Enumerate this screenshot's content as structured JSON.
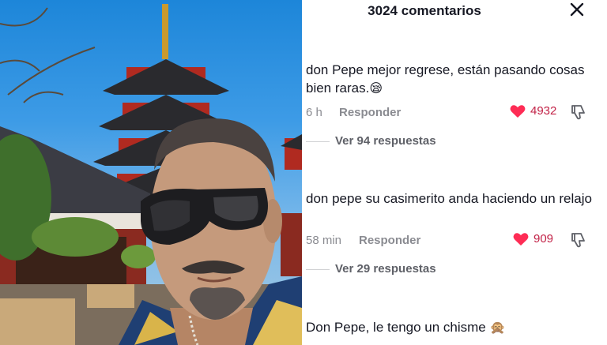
{
  "header": {
    "title": "3024 comentarios"
  },
  "comments": [
    {
      "text": "don Pepe mejor regrese, están pasando cosas bien raras.",
      "emoji": "😪",
      "time": "6 h",
      "reply_label": "Responder",
      "likes": "4932",
      "replies_label": "Ver 94 respuestas"
    },
    {
      "text": "don pepe su casimerito anda haciendo un relajo",
      "time": "58 min",
      "reply_label": "Responder",
      "likes": "909",
      "replies_label": "Ver 29 respuestas"
    },
    {
      "text": "Don Pepe, le tengo un chisme",
      "emoji": "🙊"
    }
  ],
  "colors": {
    "like_heart": "#fe2c55",
    "like_count": "#c22247",
    "muted_text": "#8a8b91"
  },
  "icons": [
    "close-icon",
    "heart-icon",
    "dislike-icon"
  ]
}
